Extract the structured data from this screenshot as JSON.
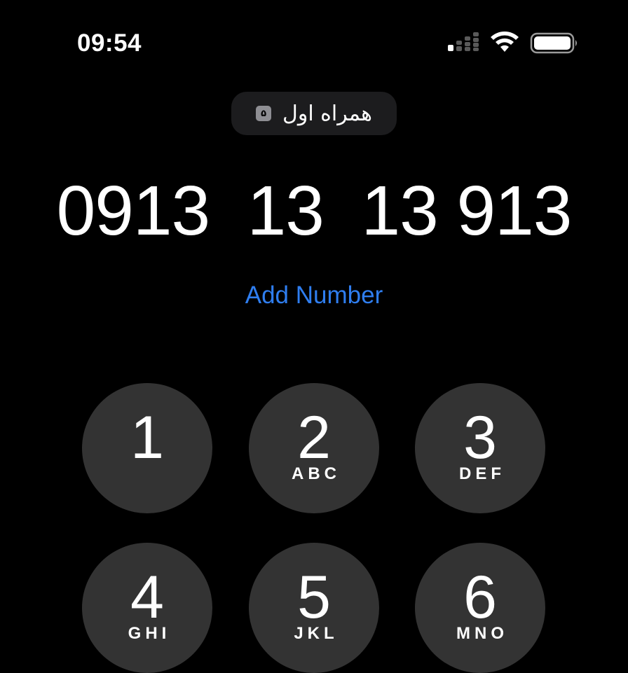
{
  "status_bar": {
    "time": "09:54",
    "signal_icon": "cellular-signal-icon",
    "wifi_icon": "wifi-icon",
    "battery_icon": "battery-icon"
  },
  "carrier": {
    "sim_label": "۵",
    "name": "همراه اول"
  },
  "dialer": {
    "number": "0913  13  13 913",
    "add_number_label": "Add Number"
  },
  "keypad": [
    {
      "digit": "1",
      "letters": ""
    },
    {
      "digit": "2",
      "letters": "ABC"
    },
    {
      "digit": "3",
      "letters": "DEF"
    },
    {
      "digit": "4",
      "letters": "GHI"
    },
    {
      "digit": "5",
      "letters": "JKL"
    },
    {
      "digit": "6",
      "letters": "MNO"
    }
  ],
  "colors": {
    "background": "#000000",
    "key_background": "#333333",
    "accent": "#2f7ef0",
    "pill_background": "#1c1c1e"
  }
}
